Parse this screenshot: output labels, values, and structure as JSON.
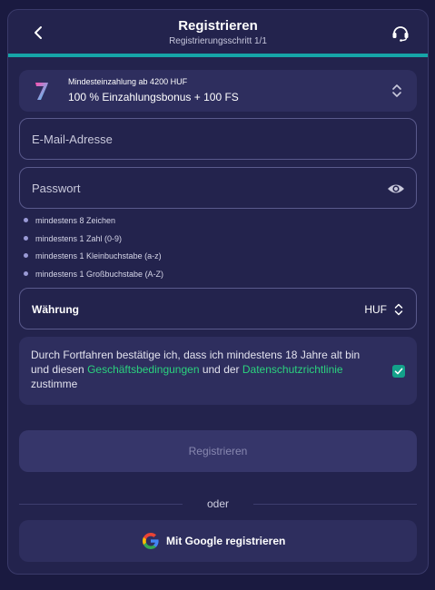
{
  "header": {
    "title": "Registrieren",
    "subtitle": "Registrierungsschritt 1/1",
    "progress": 1.0
  },
  "bonus": {
    "note": "Mindesteinzahlung ab 4200 HUF",
    "offer": "100 % Einzahlungsbonus + 100 FS"
  },
  "form": {
    "email_placeholder": "E-Mail-Adresse",
    "password_placeholder": "Passwort",
    "password_rules": [
      "mindestens 8 Zeichen",
      "mindestens 1 Zahl (0-9)",
      "mindestens 1 Kleinbuchstabe (a-z)",
      "mindestens 1 Großbuchstabe (A-Z)"
    ],
    "currency_label": "Währung",
    "currency_value": "HUF"
  },
  "terms": {
    "text_1": "Durch Fortfahren bestätige ich, dass ich mindestens 18 Jahre alt bin und diesen ",
    "link_terms": "Geschäftsbedingungen",
    "text_2": " und der ",
    "link_privacy": "Datenschutzrichtlinie",
    "text_3": " zustimme",
    "checked": true
  },
  "actions": {
    "submit_label": "Registrieren",
    "or_label": "oder",
    "google_label": "Mit Google registrieren"
  },
  "colors": {
    "page_bg": "#1a1a40",
    "panel_bg": "#23234d",
    "accent_teal": "#16a5a8",
    "link_green": "#2bd27e",
    "checkbox": "#13a18a"
  },
  "icons": {
    "back": "chevron-left-icon",
    "support": "headset-icon",
    "bonus_logo": "seven-logo-icon",
    "bonus_select": "chevron-updown-icon",
    "password_toggle": "eye-icon",
    "currency_select": "chevron-updown-icon",
    "check": "check-icon",
    "google": "google-icon"
  }
}
